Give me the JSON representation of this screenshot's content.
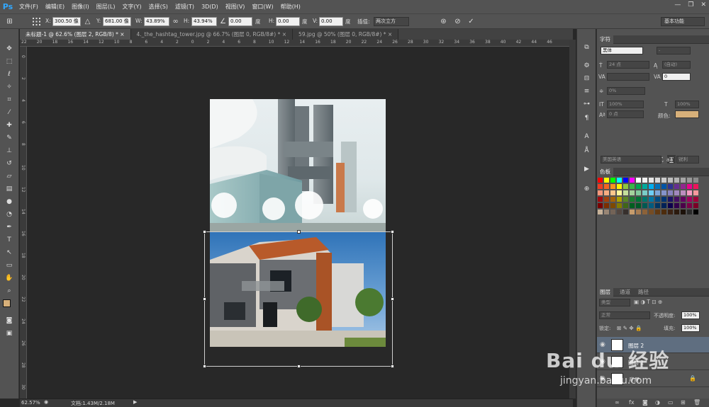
{
  "app": {
    "logo": "Ps"
  },
  "menu": [
    "文件(F)",
    "编辑(E)",
    "图像(I)",
    "图层(L)",
    "文字(Y)",
    "选择(S)",
    "滤镜(T)",
    "3D(D)",
    "视图(V)",
    "窗口(W)",
    "帮助(H)"
  ],
  "window_controls": {
    "minimize": "—",
    "restore": "❐",
    "close": "✕"
  },
  "options": {
    "x_label": "X:",
    "x_value": "300.50 像",
    "y_label": "Y:",
    "y_value": "681.00 像",
    "w_label": "W:",
    "w_value": "43.89%",
    "h_label": "H:",
    "h_value": "43.94%",
    "angle_value": "0.00",
    "angle_unit": "度",
    "hskew_label": "H:",
    "hskew_value": "0.00",
    "hskew_unit": "度",
    "vskew_label": "V:",
    "vskew_value": "0.00",
    "vskew_unit": "度",
    "interp_label": "插值:",
    "interp_value": "两次立方",
    "workspace": "基本功能"
  },
  "tabs": [
    {
      "label": "未标题-1 @ 62.6% (图层 2, RGB/8) *",
      "close": "×"
    },
    {
      "label": "4._the_hashtag_tower.jpg @ 66.7% (图层 0, RGB/8#) *",
      "close": "×"
    },
    {
      "label": "59.jpg @ 50% (图层 0, RGB/8#) *",
      "close": "×"
    }
  ],
  "ruler_h": [
    "22",
    "20",
    "18",
    "16",
    "14",
    "12",
    "10",
    "8",
    "6",
    "4",
    "2",
    "0",
    "2",
    "4",
    "6",
    "8",
    "10",
    "12",
    "14",
    "16",
    "18",
    "20",
    "22",
    "24",
    "26",
    "28",
    "30",
    "32",
    "34",
    "36",
    "38",
    "40",
    "42",
    "44",
    "46"
  ],
  "ruler_v": [
    "0",
    "2",
    "4",
    "6",
    "8",
    "10",
    "12",
    "14",
    "16",
    "18",
    "20",
    "22",
    "24",
    "26",
    "28",
    "30"
  ],
  "status": {
    "zoom": "62.57%",
    "doc": "文档:1.43M/2.18M"
  },
  "character_panel": {
    "tab": "字符",
    "font_family": "黑体",
    "font_style": "-",
    "font_size": "24 点",
    "leading": "(自动)",
    "kerning": "",
    "tracking": "0",
    "tsume": "0%",
    "vscale": "100%",
    "hscale": "100%",
    "baseline": "0 点",
    "color_label": "颜色:",
    "type_buttons": [
      "T",
      "T",
      "TT",
      "Tт",
      "T'",
      "T,",
      "T",
      "Ŧ"
    ],
    "language": "美国英语",
    "aa_label": "aa",
    "aa_value": "锐利"
  },
  "swatches_panel": {
    "tab": "色板",
    "colors": [
      "#ff0000",
      "#ffff00",
      "#00ff00",
      "#00ffff",
      "#0000ff",
      "#ff00ff",
      "#ffffff",
      "#f2f2f2",
      "#e6e6e6",
      "#d9d9d9",
      "#cccccc",
      "#bfbfbf",
      "#b3b3b3",
      "#a6a6a6",
      "#999999",
      "#8c8c8c",
      "#ee3d23",
      "#f26522",
      "#f7941d",
      "#fff200",
      "#8dc63f",
      "#39b54a",
      "#00a651",
      "#00a99d",
      "#00aeef",
      "#0072bc",
      "#0054a6",
      "#2e3192",
      "#662d91",
      "#92278f",
      "#ec008c",
      "#ed145b",
      "#f7977a",
      "#f9ad81",
      "#fdc68a",
      "#fff79a",
      "#c4df9b",
      "#a3d39c",
      "#82ca9d",
      "#7accc8",
      "#6dcff6",
      "#7da7d9",
      "#8493ca",
      "#8882be",
      "#a187be",
      "#bc8dbf",
      "#f49ac2",
      "#f6989d",
      "#9e0b0f",
      "#a0410d",
      "#a3620a",
      "#aba000",
      "#598527",
      "#1a7b30",
      "#007236",
      "#00746b",
      "#0076a3",
      "#004b80",
      "#003471",
      "#1b1464",
      "#440e62",
      "#630460",
      "#9e005d",
      "#9e0039",
      "#790000",
      "#7b2e00",
      "#7d4900",
      "#827b00",
      "#406618",
      "#005e20",
      "#005826",
      "#005952",
      "#005b7f",
      "#003663",
      "#002157",
      "#0d004c",
      "#32004b",
      "#4b0049",
      "#7b0046",
      "#7a0026",
      "#c7b299",
      "#998675",
      "#736357",
      "#534741",
      "#37302d",
      "#c69c6d",
      "#a67c52",
      "#8c6239",
      "#754c24",
      "#603913",
      "#4d2c0d",
      "#3b2314",
      "#2b1a0e",
      "#1c110a",
      "#2b2b2b",
      "#000000"
    ]
  },
  "layers_panel": {
    "tabs": [
      "图层",
      "通道",
      "路径"
    ],
    "filter": "类型",
    "blend": "正常",
    "opacity_label": "不透明度:",
    "opacity": "100%",
    "lock_label": "锁定:",
    "fill_label": "填充:",
    "fill": "100%",
    "layers": [
      {
        "name": "图层 2",
        "selected": true
      },
      {
        "name": "图层 1",
        "selected": false
      },
      {
        "name": "背景",
        "selected": false
      }
    ]
  },
  "watermark": {
    "brand": "Bai du 经验",
    "url": "jingyan.baidu.com"
  }
}
